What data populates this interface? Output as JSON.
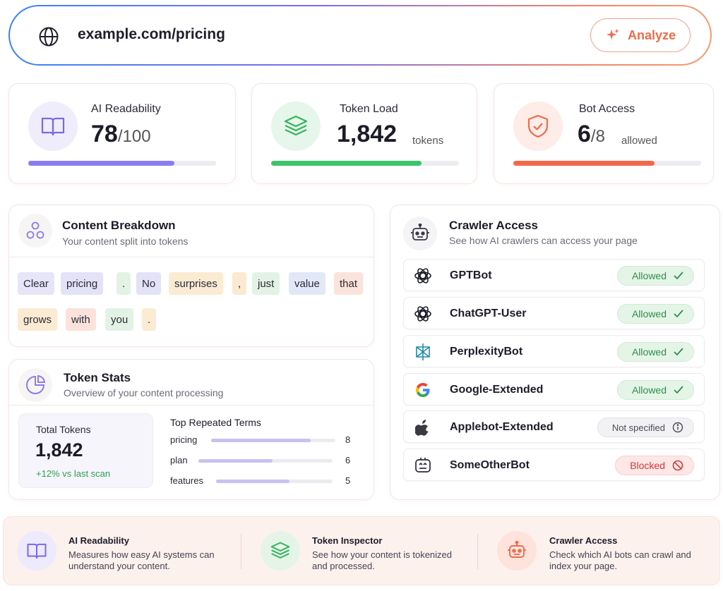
{
  "urlbar": {
    "url": "example.com/pricing",
    "analyze_label": "Analyze"
  },
  "metrics": {
    "readability": {
      "label": "AI Readability",
      "value": "78",
      "suffix": "/100",
      "progress": 0.78,
      "color": "#8b7cf0"
    },
    "token_load": {
      "label": "Token Load",
      "value": "1,842",
      "unit": "tokens",
      "progress": 0.8,
      "color": "#3cc46a"
    },
    "bot_access": {
      "label": "Bot Access",
      "value": "6",
      "suffix": "/8",
      "unit": "allowed",
      "progress": 0.75,
      "color": "#f2694a"
    }
  },
  "breakdown": {
    "title": "Content Breakdown",
    "subtitle": "Your content split into tokens",
    "tokens": [
      "Clear",
      "pricing",
      ".",
      "No",
      "surprises",
      ",",
      "just",
      "value",
      "that",
      "grows",
      "with",
      "you",
      "."
    ]
  },
  "stats": {
    "title": "Token Stats",
    "subtitle": "Overview of your content processing",
    "total_label": "Total Tokens",
    "total_value": "1,842",
    "change": "+12% vs last scan",
    "terms_title": "Top Repeated Terms",
    "terms": [
      {
        "term": "pricing",
        "count": "8",
        "fraction": 0.8
      },
      {
        "term": "plan",
        "count": "6",
        "fraction": 0.55
      },
      {
        "term": "features",
        "count": "5",
        "fraction": 0.63
      }
    ]
  },
  "crawler": {
    "title": "Crawler Access",
    "subtitle": "See how AI crawlers can access your page",
    "bots": [
      {
        "name": "GPTBot",
        "status": "Allowed",
        "icon": "openai-icon"
      },
      {
        "name": "ChatGPT-User",
        "status": "Allowed",
        "icon": "openai-icon"
      },
      {
        "name": "PerplexityBot",
        "status": "Allowed",
        "icon": "perplexity-icon"
      },
      {
        "name": "Google-Extended",
        "status": "Allowed",
        "icon": "google-icon"
      },
      {
        "name": "Applebot-Extended",
        "status": "Not specified",
        "icon": "apple-icon"
      },
      {
        "name": "SomeOtherBot",
        "status": "Blocked",
        "icon": "robot-icon"
      }
    ]
  },
  "footer": [
    {
      "title": "AI Readability",
      "desc": "Measures how easy AI systems can understand your content."
    },
    {
      "title": "Token Inspector",
      "desc": "See how your content is tokenized and processed."
    },
    {
      "title": "Crawler Access",
      "desc": "Check which AI bots can crawl and index your page."
    }
  ]
}
